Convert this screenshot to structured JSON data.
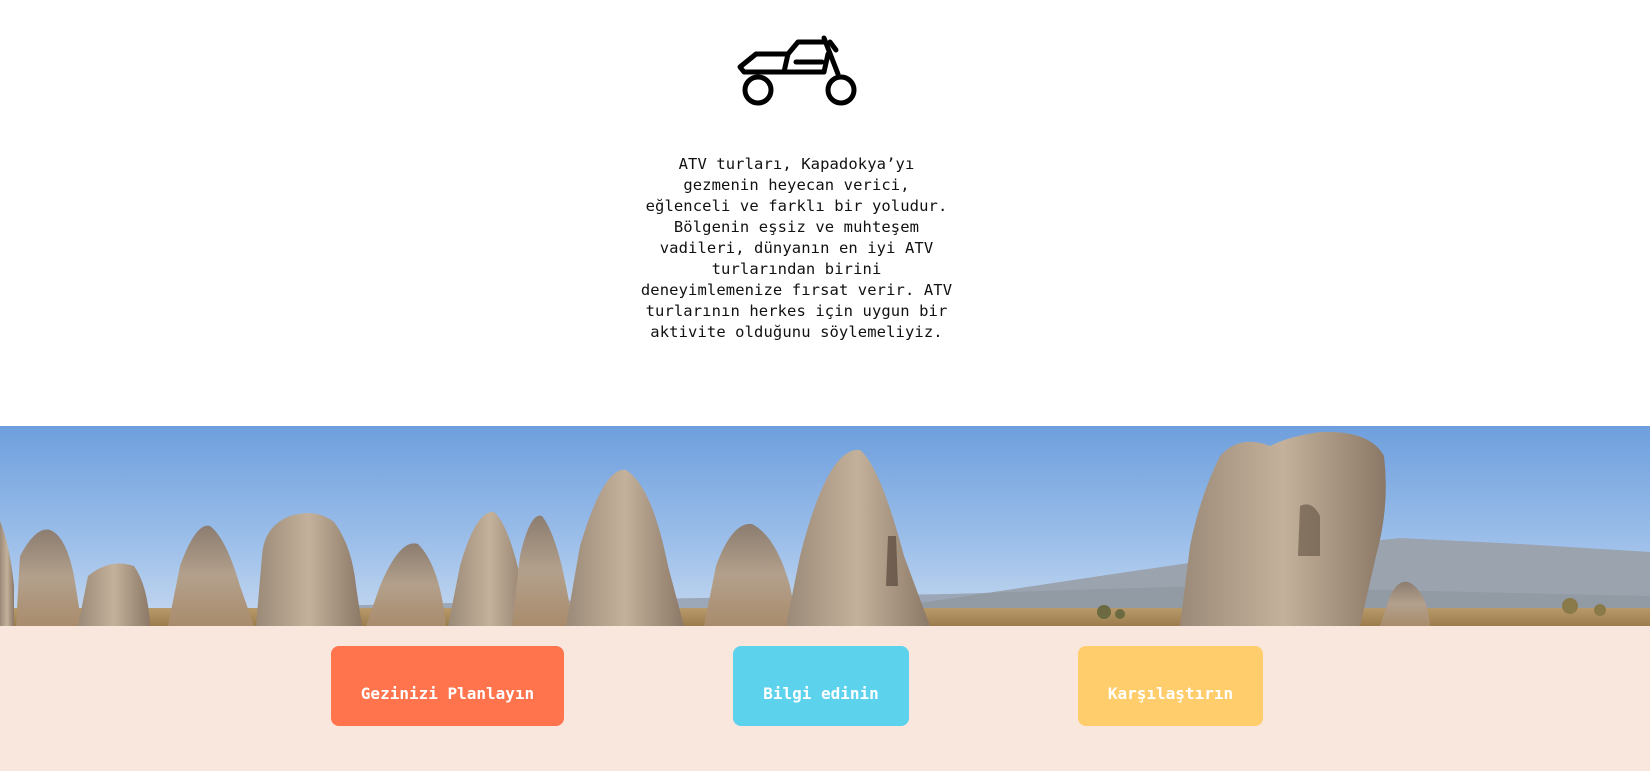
{
  "hero": {
    "icon": "motorcycle-icon",
    "description": "ATV turları, Kapadokya’yı gezmenin heyecan verici, eğlenceli ve farklı bir yoludur. Bölgenin eşsiz ve muhteşem vadileri, dünyanın en iyi ATV turlarından birini deneyimlemenize fırsat verir. ATV turlarının herkes için uygun bir aktivite olduğunu söylemeliyiz."
  },
  "banner": {
    "image": "cappadocia-fairy-chimneys-photo"
  },
  "actions": {
    "plan_label": "Gezinizi Planlayın",
    "info_label": "Bilgi edinin",
    "compare_label": "Karşılaştırın"
  },
  "colors": {
    "plan": "#ff734d",
    "info": "#5dd2ec",
    "compare": "#ffcd6b",
    "bottom_bg": "#f9e6dc"
  }
}
